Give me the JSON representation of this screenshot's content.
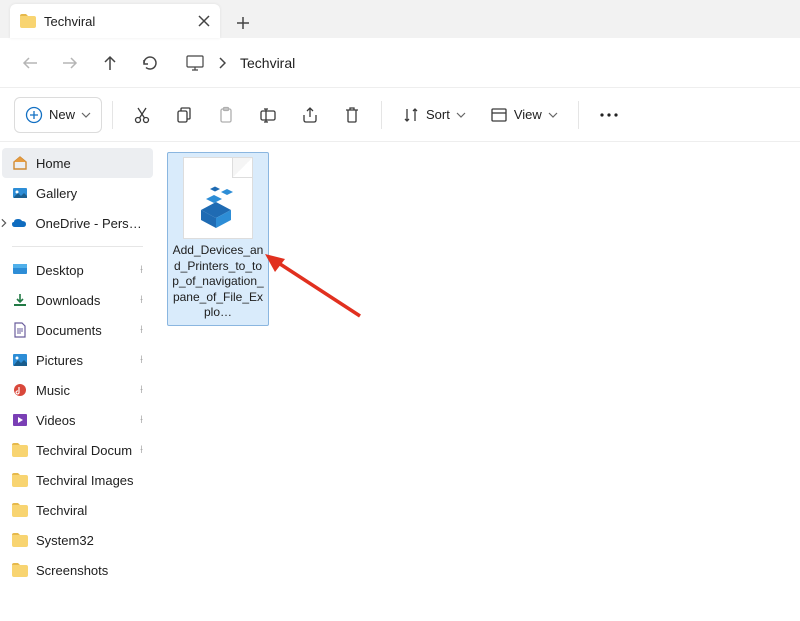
{
  "tab": {
    "title": "Techviral",
    "folder_icon": "folder-icon"
  },
  "breadcrumb": {
    "current": "Techviral"
  },
  "toolbar": {
    "new_label": "New",
    "sort_label": "Sort",
    "view_label": "View"
  },
  "sidebar": {
    "home": "Home",
    "gallery": "Gallery",
    "onedrive": "OneDrive - Persona",
    "quick": [
      {
        "label": "Desktop",
        "icon": "desktop"
      },
      {
        "label": "Downloads",
        "icon": "downloads"
      },
      {
        "label": "Documents",
        "icon": "documents"
      },
      {
        "label": "Pictures",
        "icon": "pictures"
      },
      {
        "label": "Music",
        "icon": "music"
      },
      {
        "label": "Videos",
        "icon": "videos"
      },
      {
        "label": "Techviral Docum",
        "icon": "folder"
      },
      {
        "label": "Techviral Images",
        "icon": "folder"
      },
      {
        "label": "Techviral",
        "icon": "folder"
      },
      {
        "label": "System32",
        "icon": "folder"
      },
      {
        "label": "Screenshots",
        "icon": "folder"
      }
    ]
  },
  "files": [
    {
      "name": "Add_Devices_and_Printers_to_top_of_navigation_pane_of_File_Explo…",
      "type": "reg"
    }
  ]
}
